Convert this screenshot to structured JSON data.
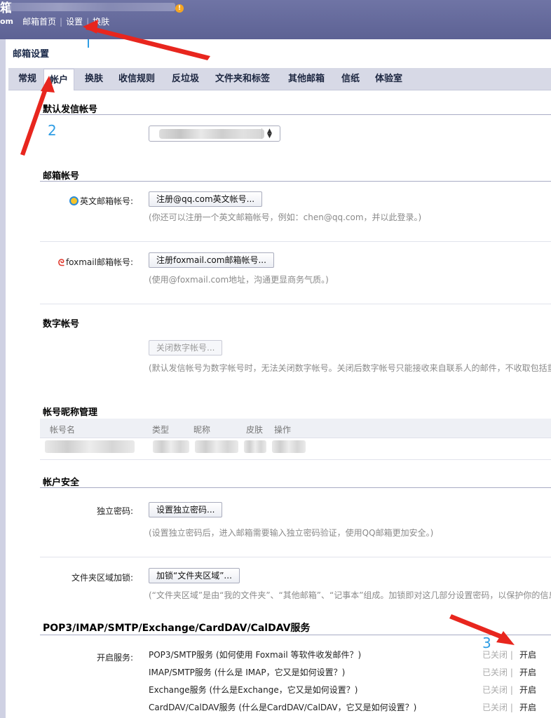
{
  "header": {
    "logo_fragment_top": "箱",
    "logo_fragment_bottom": "om",
    "nav": [
      "邮箱首页",
      "设置",
      "换肤"
    ]
  },
  "settings": {
    "title": "邮箱设置",
    "tabs": [
      "常规",
      "帐户",
      "换肤",
      "收信规则",
      "反垃圾",
      "文件夹和标签",
      "其他邮箱",
      "信纸",
      "体验室"
    ],
    "active_tab": "帐户"
  },
  "default_sender": {
    "title": "默认发信帐号"
  },
  "mail_accounts": {
    "title": "邮箱帐号",
    "english_label": "英文邮箱帐号:",
    "english_button": "注册@qq.com英文帐号...",
    "english_hint": "(你还可以注册一个英文邮箱帐号，例如：chen@qq.com，并以此登录。)",
    "foxmail_label": "foxmail邮箱帐号:",
    "foxmail_button": "注册foxmail.com邮箱帐号...",
    "foxmail_hint": "(使用@foxmail.com地址，沟通更显商务气质。)"
  },
  "numeric_account": {
    "title": "数字帐号",
    "button": "关闭数字帐号...",
    "hint": "(默认发信帐号为数字帐号时，无法关闭数字帐号。关闭后数字帐号只能接收来自联系人的邮件，不收取包括重"
  },
  "nickname": {
    "title": "帐号昵称管理",
    "columns": [
      "帐号名",
      "类型",
      "昵称",
      "皮肤",
      "操作"
    ]
  },
  "security": {
    "title": "帐户安全",
    "password_label": "独立密码:",
    "password_button": "设置独立密码...",
    "password_hint": "(设置独立密码后，进入邮箱需要输入独立密码验证，使用QQ邮箱更加安全。)",
    "folder_label": "文件夹区域加锁:",
    "folder_button": "加锁“文件夹区域”...",
    "folder_hint": "(“文件夹区域”是由“我的文件夹”、“其他邮箱”、“记事本”组成。加锁即对这几部分设置密码，以保护你的信息"
  },
  "services": {
    "title": "POP3/IMAP/SMTP/Exchange/CardDAV/CalDAV服务",
    "label": "开启服务:",
    "items": [
      {
        "name": "POP3/SMTP服务 (如何使用 Foxmail 等软件收发邮件？)",
        "status": "已关闭",
        "action": "开启"
      },
      {
        "name": "IMAP/SMTP服务 (什么是 IMAP，它又是如何设置？)",
        "status": "已关闭",
        "action": "开启"
      },
      {
        "name": "Exchange服务 (什么是Exchange，它又是如何设置？)",
        "status": "已关闭",
        "action": "开启"
      },
      {
        "name": "CardDAV/CalDAV服务 (什么是CardDAV/CalDAV，它又是如何设置？)",
        "status": "已关闭",
        "action": "开启"
      }
    ],
    "separator": "|"
  },
  "annotations": {
    "step2": "2",
    "step3": "3",
    "arrow_color": "#e8261e"
  }
}
